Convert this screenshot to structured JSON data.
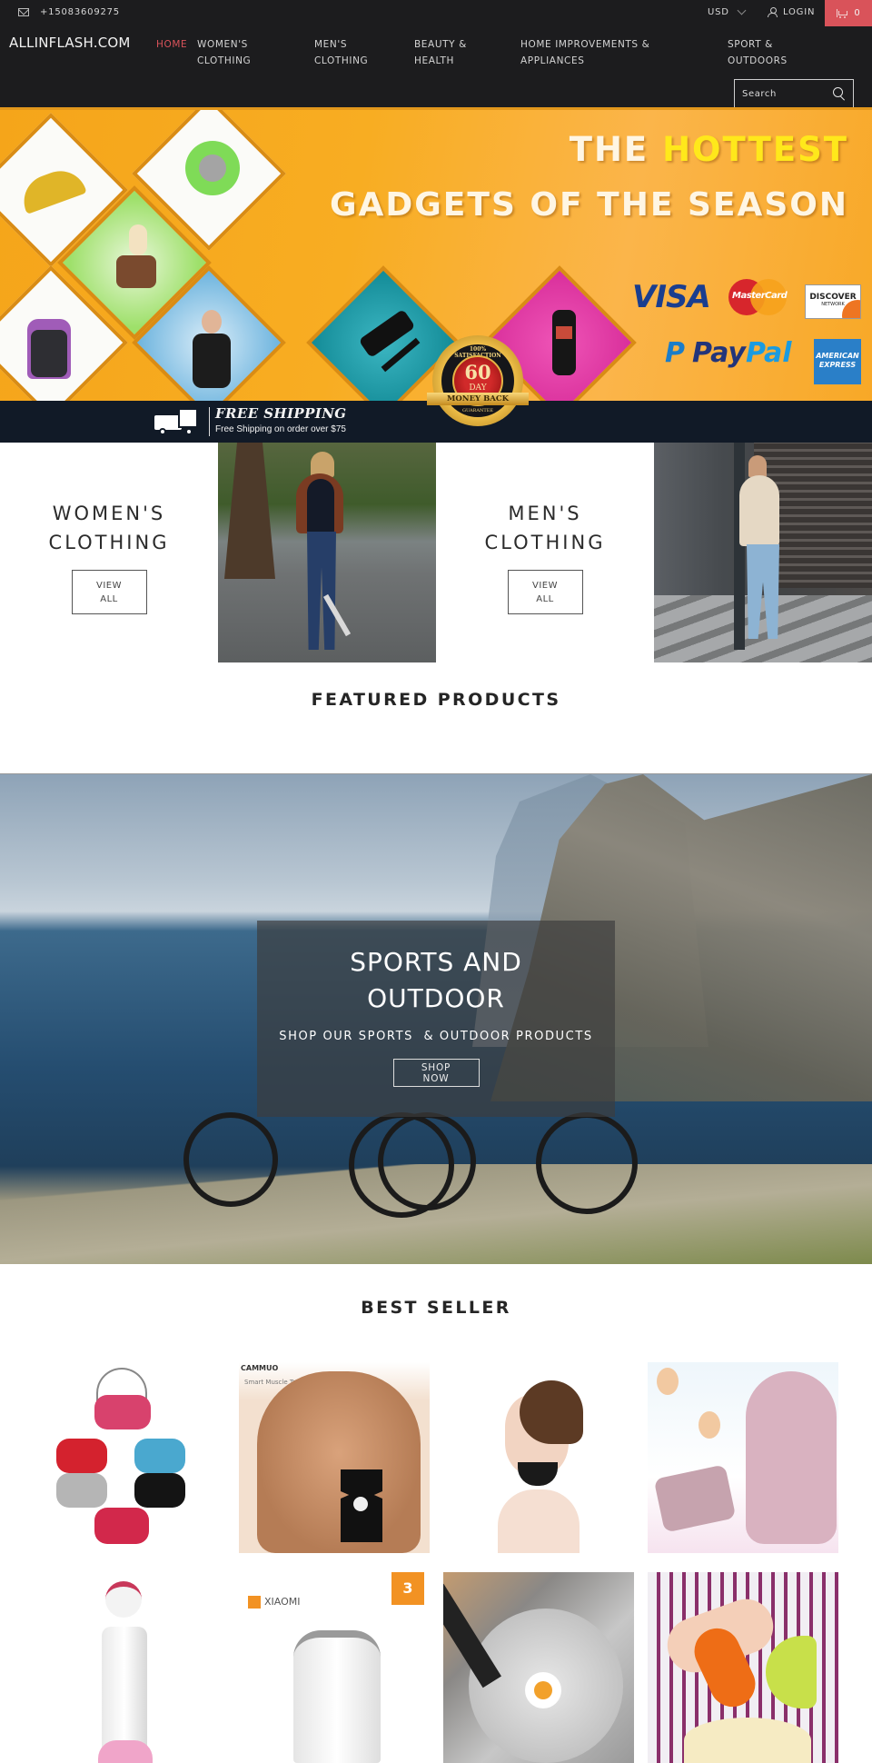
{
  "topbar": {
    "phone": "+15083609275",
    "currency": "USD",
    "login_label": "LOGIN",
    "cart_count": "0",
    "cart_color": "#d9535a"
  },
  "header": {
    "logo": "ALLINFLASH.COM",
    "nav": [
      {
        "label": "HOME",
        "active": true
      },
      {
        "label": "WOMEN'S\nCLOTHING",
        "active": false
      },
      {
        "label": "MEN'S\nCLOTHING",
        "active": false
      },
      {
        "label": "BEAUTY &\nHEALTH",
        "active": false
      },
      {
        "label": "HOME IMPROVEMENTS &\nAPPLIANCES",
        "active": false
      },
      {
        "label": "SPORT &\nOUTDOORS",
        "active": false
      }
    ],
    "search_placeholder": "Search",
    "active_color": "#d9535a"
  },
  "hero": {
    "title_prefix": "THE ",
    "title_highlight": "HOTTEST",
    "title_line2": "GADGETS OF THE SEASON",
    "payment_methods": [
      "VISA",
      "MasterCard",
      "DISCOVER",
      "PayPal",
      "AMERICAN EXPRESS"
    ],
    "discover_sub": "NETWORK",
    "paypal_pay": "Pay",
    "paypal_pal": "Pal",
    "amex_line1": "AMERICAN",
    "amex_line2": "EXPRESS",
    "shipping_title": "FREE SHIPPING",
    "shipping_sub": "Free Shipping on order over $75",
    "seal_top": "100% SATISFACTION",
    "seal_number": "60",
    "seal_day": "DAY",
    "seal_ribbon": "MONEY BACK",
    "seal_bottom": "GUARANTEE"
  },
  "categories": [
    {
      "title": "WOMEN'S\nCLOTHING",
      "button": "VIEW\nALL"
    },
    {
      "title": "MEN'S\nCLOTHING",
      "button": "VIEW\nALL"
    }
  ],
  "featured": {
    "title": "FEATURED PRODUCTS"
  },
  "sports": {
    "title": "SPORTS AND\nOUTDOOR",
    "subtitle": "SHOP OUR SPORTS  & OUTDOOR PRODUCTS",
    "button": "SHOP\nNOW"
  },
  "best_seller": {
    "title": "BEST SELLER",
    "products": [
      {
        "name": "sleep-eye-mask"
      },
      {
        "name": "smart-muscle-trainer",
        "brand": "CAMMUO",
        "caption": "Smart Muscle Trainer"
      },
      {
        "name": "v-face-chin-strap"
      },
      {
        "name": "face-lift-mask"
      },
      {
        "name": "ice-cream-maker"
      },
      {
        "name": "xiaomi-kettle",
        "brand": "XIAOMI",
        "badge": "3"
      },
      {
        "name": "egg-spatula"
      },
      {
        "name": "vegetable-spiralizer"
      }
    ]
  }
}
